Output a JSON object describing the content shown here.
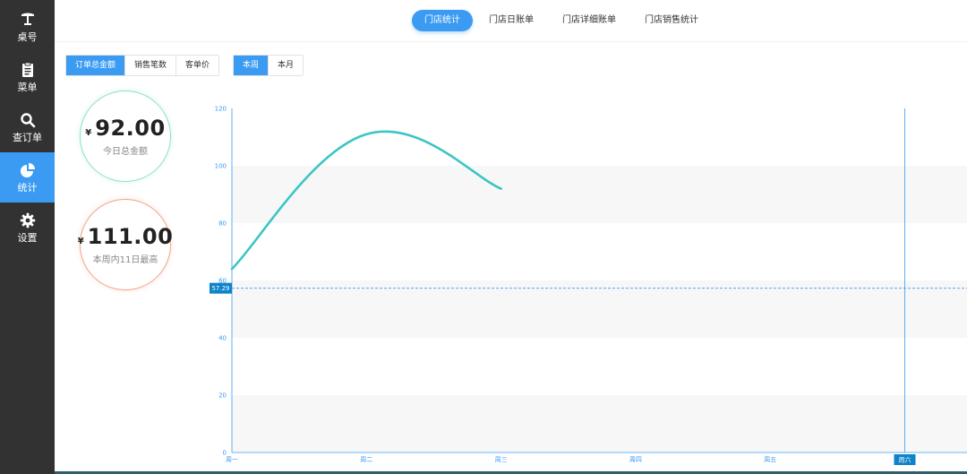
{
  "sidebar": {
    "items": [
      {
        "label": "桌号",
        "icon": "table-icon",
        "active": false
      },
      {
        "label": "菜单",
        "icon": "clipboard-icon",
        "active": false
      },
      {
        "label": "查订单",
        "icon": "search-icon",
        "active": false
      },
      {
        "label": "统计",
        "icon": "pie-chart-icon",
        "active": true
      },
      {
        "label": "设置",
        "icon": "gear-icon",
        "active": false
      }
    ]
  },
  "top_tabs": [
    {
      "label": "门店统计",
      "active": true
    },
    {
      "label": "门店日账单",
      "active": false
    },
    {
      "label": "门店详细账单",
      "active": false
    },
    {
      "label": "门店销售统计",
      "active": false
    }
  ],
  "metric_buttons": [
    {
      "label": "订单总金额",
      "active": true
    },
    {
      "label": "销售笔数",
      "active": false
    },
    {
      "label": "客单价",
      "active": false
    }
  ],
  "period_buttons": [
    {
      "label": "本周",
      "active": true
    },
    {
      "label": "本月",
      "active": false
    }
  ],
  "stats": {
    "today": {
      "currency": "¥",
      "amount": "92.00",
      "caption": "今日总金额"
    },
    "week_max": {
      "currency": "¥",
      "amount": "111.00",
      "caption": "本周内11日最高"
    }
  },
  "colors": {
    "accent": "#3b9bf2",
    "line": "#3cc5c5",
    "green_ring": "#8fe0c6",
    "orange_ring": "#f0a58b"
  },
  "chart_data": {
    "type": "line",
    "categories": [
      "周一",
      "周二",
      "周三",
      "周四",
      "周五",
      "周六"
    ],
    "series": [
      {
        "values": [
          64,
          111,
          92
        ]
      }
    ],
    "ylim": [
      0,
      120
    ],
    "yticks": [
      0,
      20,
      40,
      60,
      80,
      100,
      120
    ],
    "grid": true,
    "crosshair": {
      "y_value": 57.29,
      "y_label": "57.29",
      "x_label": "周六"
    }
  }
}
